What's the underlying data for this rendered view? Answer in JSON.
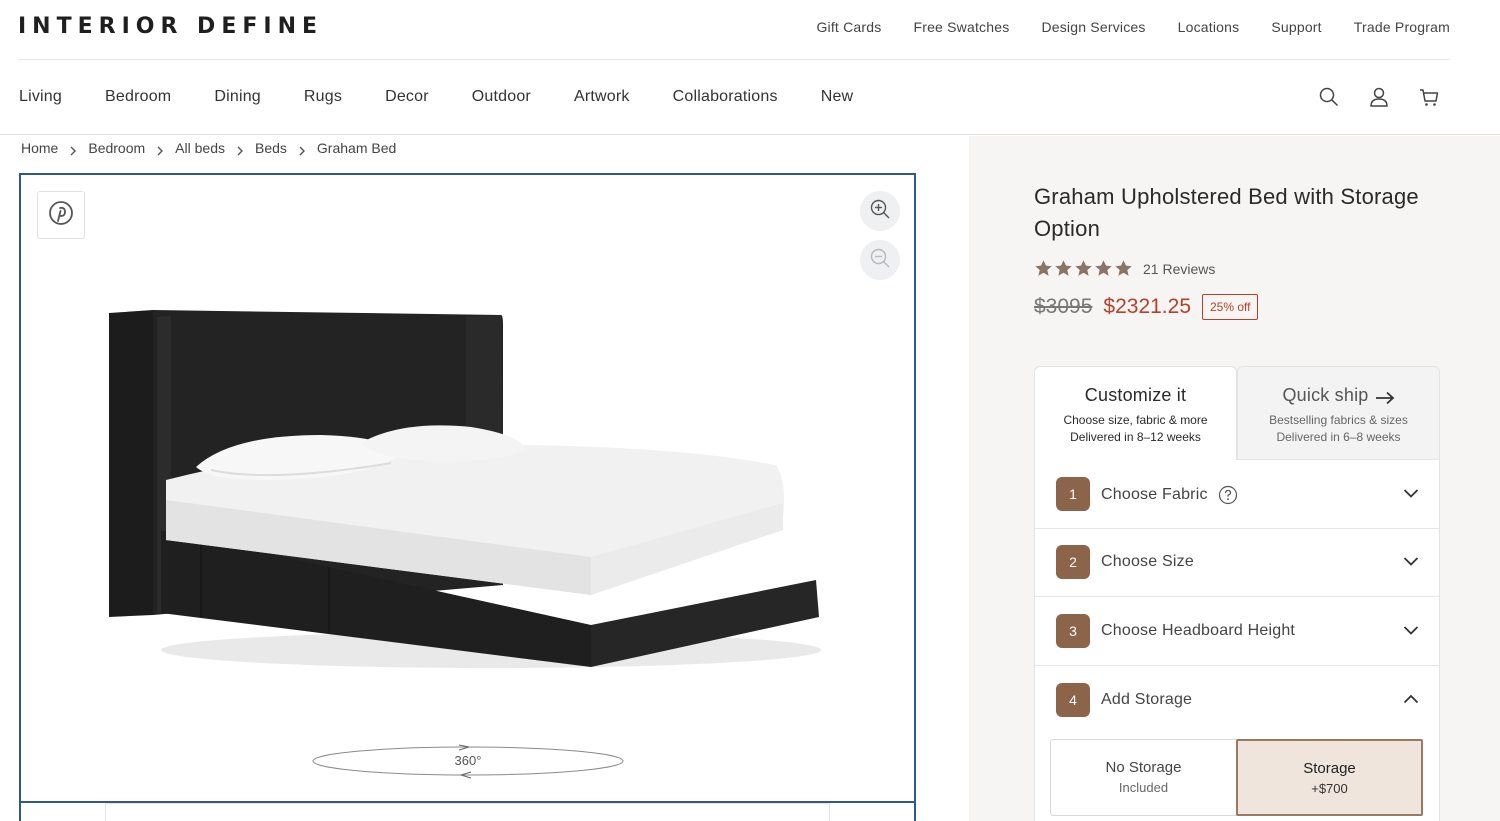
{
  "brand": {
    "logo": "INTERIOR DEFINE"
  },
  "utility_links": [
    "Gift Cards",
    "Free Swatches",
    "Design Services",
    "Locations",
    "Support",
    "Trade Program"
  ],
  "main_nav": [
    "Living",
    "Bedroom",
    "Dining",
    "Rugs",
    "Decor",
    "Outdoor",
    "Artwork",
    "Collaborations",
    "New"
  ],
  "header_icons": [
    "search-icon",
    "account-icon",
    "cart-icon"
  ],
  "breadcrumb": [
    "Home",
    "Bedroom",
    "All beds",
    "Beds",
    "Graham Bed"
  ],
  "viewer": {
    "rotate_label": "360°",
    "icons": [
      "pinterest-icon",
      "zoom-in-icon",
      "zoom-out-icon"
    ]
  },
  "product": {
    "title": "Graham Upholstered Bed with Storage Option",
    "rating": 5,
    "reviews": "21 Reviews",
    "old_price": "$3095",
    "new_price": "$2321.25",
    "discount_badge": "25% off",
    "sale_color": "#b8402b"
  },
  "tabs": {
    "customize": {
      "title": "Customize it",
      "line1": "Choose size, fabric & more",
      "line2": "Delivered in 8–12 weeks"
    },
    "quickship": {
      "title": "Quick ship",
      "line1": "Bestselling fabrics & sizes",
      "line2": "Delivered in 6–8 weeks"
    }
  },
  "steps": [
    {
      "num": "1",
      "label": "Choose Fabric",
      "expanded": false,
      "help": true
    },
    {
      "num": "2",
      "label": "Choose Size",
      "expanded": false,
      "help": false
    },
    {
      "num": "3",
      "label": "Choose Headboard Height",
      "expanded": false,
      "help": false
    },
    {
      "num": "4",
      "label": "Add Storage",
      "expanded": true,
      "help": false
    }
  ],
  "storage_options": [
    {
      "label": "No Storage",
      "sub": "Included",
      "selected": false
    },
    {
      "label": "Storage",
      "sub": "+$700",
      "selected": true
    }
  ],
  "colors": {
    "step_badge": "#8c6449",
    "selected_option_bg": "#efe5dc",
    "viewer_border": "#2d5b86"
  }
}
